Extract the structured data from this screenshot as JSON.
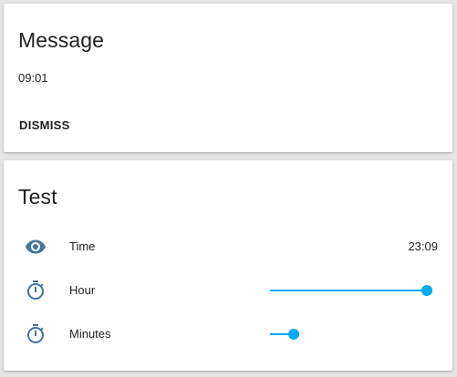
{
  "accent_color": "#03a9f4",
  "icon_color": "#44739e",
  "message_card": {
    "title": "Message",
    "text": "09:01",
    "dismiss_label": "DISMISS"
  },
  "test_card": {
    "title": "Test",
    "rows": [
      {
        "icon": "eye-icon",
        "label": "Time",
        "value": "23:09"
      },
      {
        "icon": "timer-icon",
        "label": "Hour",
        "slider_fraction": 1.0
      },
      {
        "icon": "timer-icon",
        "label": "Minutes",
        "slider_fraction": 0.15
      }
    ]
  }
}
